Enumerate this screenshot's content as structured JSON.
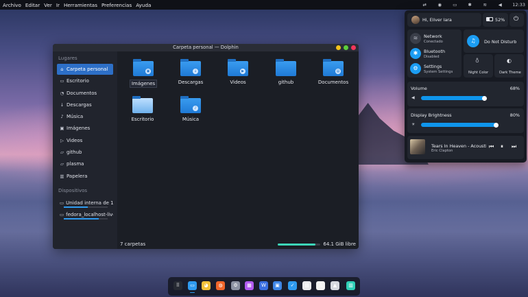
{
  "menubar": {
    "items": [
      "Archivo",
      "Editar",
      "Ver",
      "Ir",
      "Herramientas",
      "Preferencias",
      "Ayuda"
    ],
    "clock": "12:33"
  },
  "window": {
    "title": "Carpeta personal — Dolphin",
    "places_header": "Lugares",
    "places": [
      {
        "label": "Carpeta personal",
        "icon": "home-icon"
      },
      {
        "label": "Escritorio",
        "icon": "desktop-icon"
      },
      {
        "label": "Documentos",
        "icon": "documents-icon"
      },
      {
        "label": "Descargas",
        "icon": "download-icon"
      },
      {
        "label": "Música",
        "icon": "music-icon"
      },
      {
        "label": "Imágenes",
        "icon": "image-icon"
      },
      {
        "label": "Videos",
        "icon": "video-icon"
      },
      {
        "label": "github",
        "icon": "folder-icon"
      },
      {
        "label": "plasma",
        "icon": "folder-icon"
      },
      {
        "label": "Papelera",
        "icon": "trash-icon"
      }
    ],
    "devices_header": "Dispositivos",
    "devices": [
      {
        "label": "Unidad interna de 1...",
        "usage": 0.55
      },
      {
        "label": "fedora_localhost-live",
        "usage": 0.8
      }
    ],
    "files": [
      {
        "label": "Imágenes",
        "icon": "image-folder-icon",
        "badge": "▣"
      },
      {
        "label": "Descargas",
        "icon": "download-folder-icon",
        "badge": "↓"
      },
      {
        "label": "Videos",
        "icon": "video-folder-icon",
        "badge": "▶"
      },
      {
        "label": "github",
        "icon": "folder-icon",
        "badge": ""
      },
      {
        "label": "Documentos",
        "icon": "documents-folder-icon",
        "badge": "▤"
      },
      {
        "label": "Escritorio",
        "icon": "desktop-folder-icon",
        "badge": ""
      },
      {
        "label": "Música",
        "icon": "music-folder-icon",
        "badge": "♪"
      }
    ],
    "status_left": "7 carpetas",
    "free_space": "64.1 GiB libre",
    "disk_usage": 0.88
  },
  "control_center": {
    "greeting": "Hi, Eliver lara",
    "battery": "52%",
    "network": {
      "title": "Network",
      "subtitle": "Conectado"
    },
    "dnd": {
      "title": "Do Not Disturb"
    },
    "bluetooth": {
      "title": "Bluetooth",
      "subtitle": "Disabled"
    },
    "settings": {
      "title": "Settings",
      "subtitle": "System Settings"
    },
    "night_color": "Night Color",
    "dark_theme": "Dark Theme",
    "volume": {
      "label": "Volume",
      "value": "68%",
      "level": 0.68
    },
    "brightness": {
      "label": "Display Brightness",
      "value": "80%",
      "level": 0.8
    },
    "media": {
      "title": "Tears In Heaven - Acoustic; ...",
      "artist": "Eric Clapton"
    }
  },
  "dock": {
    "apps": [
      {
        "name": "app-grid-icon",
        "color": "#262a33"
      },
      {
        "name": "dolphin-icon",
        "color": "#2f9bf0",
        "running": true
      },
      {
        "name": "chrome-icon",
        "color": "#f2c13a"
      },
      {
        "name": "firefox-icon",
        "color": "#f0662a"
      },
      {
        "name": "settings-app-icon",
        "color": "#8d93a3"
      },
      {
        "name": "store-icon",
        "color": "#b25cf0"
      },
      {
        "name": "office-icon",
        "color": "#3a6ee0"
      },
      {
        "name": "gallery-icon",
        "color": "#3f86e6"
      },
      {
        "name": "code-icon",
        "color": "#2f9bf0"
      },
      {
        "name": "notes-icon",
        "color": "#e9e9ec"
      },
      {
        "name": "tshirt-icon",
        "color": "#f2f2f2"
      },
      {
        "name": "tool-icon",
        "color": "#d8dae0"
      },
      {
        "name": "trash-dock-icon",
        "color": "#2fcfb5"
      }
    ]
  }
}
